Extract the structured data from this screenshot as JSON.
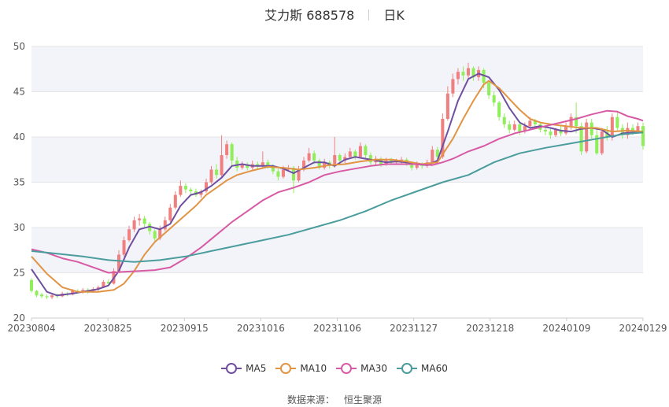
{
  "header": {
    "name": "艾力斯 688578",
    "period": "日K"
  },
  "source": {
    "label": "数据来源：",
    "provider": "恒生聚源"
  },
  "colors": {
    "up": "#f08080",
    "down": "#90ee5a",
    "grid": "#e6e6e6",
    "band": "#f3f4fa"
  },
  "chart_data": {
    "type": "candlestick",
    "ylim": [
      20,
      50
    ],
    "yticks": [
      20,
      25,
      30,
      35,
      40,
      45,
      50
    ],
    "xticks": [
      "20230804",
      "20230825",
      "20230915",
      "20231016",
      "20231106",
      "20231127",
      "20231218",
      "20240109",
      "20240129"
    ],
    "n_bars": 120,
    "candles": [
      [
        24.2,
        23.0,
        24.4,
        22.8
      ],
      [
        23.0,
        22.5,
        23.1,
        22.3
      ],
      [
        22.6,
        22.4,
        22.8,
        22.2
      ],
      [
        22.4,
        22.3,
        22.6,
        22.1
      ],
      [
        22.3,
        22.5,
        22.7,
        22.1
      ],
      [
        22.5,
        22.4,
        22.7,
        22.2
      ],
      [
        22.4,
        22.7,
        22.9,
        22.3
      ],
      [
        22.7,
        22.6,
        22.9,
        22.4
      ],
      [
        22.6,
        23.0,
        23.2,
        22.5
      ],
      [
        23.0,
        22.9,
        23.2,
        22.7
      ],
      [
        22.9,
        23.1,
        23.3,
        22.7
      ],
      [
        23.1,
        22.9,
        23.3,
        22.7
      ],
      [
        22.9,
        23.2,
        23.4,
        22.8
      ],
      [
        23.2,
        23.4,
        23.6,
        23.0
      ],
      [
        23.4,
        24.0,
        24.2,
        23.3
      ],
      [
        24.0,
        23.8,
        24.3,
        23.6
      ],
      [
        23.8,
        25.2,
        25.5,
        23.7
      ],
      [
        25.2,
        27.0,
        27.5,
        25.0
      ],
      [
        27.0,
        28.6,
        29.0,
        26.8
      ],
      [
        28.6,
        29.8,
        30.2,
        28.4
      ],
      [
        29.8,
        30.8,
        31.2,
        29.5
      ],
      [
        30.8,
        31.0,
        31.5,
        30.2
      ],
      [
        31.0,
        30.4,
        31.3,
        30.0
      ],
      [
        30.4,
        29.6,
        30.6,
        29.2
      ],
      [
        29.6,
        28.8,
        29.8,
        28.5
      ],
      [
        28.8,
        29.8,
        30.2,
        28.6
      ],
      [
        29.8,
        30.8,
        31.2,
        29.6
      ],
      [
        30.8,
        32.2,
        32.6,
        30.6
      ],
      [
        32.2,
        33.6,
        34.0,
        32.0
      ],
      [
        33.6,
        34.6,
        35.2,
        33.4
      ],
      [
        34.6,
        34.2,
        34.9,
        33.8
      ],
      [
        34.2,
        34.0,
        34.4,
        33.7
      ],
      [
        34.0,
        33.6,
        34.3,
        33.4
      ],
      [
        33.6,
        34.0,
        34.2,
        33.3
      ],
      [
        34.0,
        35.0,
        35.4,
        33.8
      ],
      [
        35.0,
        36.4,
        36.8,
        34.8
      ],
      [
        36.4,
        35.8,
        37.0,
        35.4
      ],
      [
        35.8,
        38.0,
        40.2,
        35.6
      ],
      [
        38.0,
        39.2,
        39.6,
        37.6
      ],
      [
        39.2,
        37.4,
        39.4,
        36.8
      ],
      [
        37.4,
        36.6,
        37.8,
        36.2
      ],
      [
        36.6,
        36.9,
        37.3,
        36.4
      ],
      [
        36.9,
        36.6,
        37.2,
        36.3
      ],
      [
        36.6,
        37.0,
        37.4,
        36.4
      ],
      [
        37.0,
        36.8,
        37.3,
        36.5
      ],
      [
        36.8,
        37.2,
        38.4,
        36.6
      ],
      [
        37.2,
        36.8,
        37.5,
        36.5
      ],
      [
        36.8,
        36.2,
        37.0,
        35.9
      ],
      [
        36.2,
        35.6,
        36.5,
        35.2
      ],
      [
        35.6,
        36.4,
        36.8,
        35.4
      ],
      [
        36.4,
        36.6,
        36.9,
        36.2
      ],
      [
        36.6,
        35.2,
        36.8,
        33.8
      ],
      [
        35.2,
        36.4,
        36.8,
        35.0
      ],
      [
        36.4,
        37.4,
        37.8,
        36.2
      ],
      [
        37.4,
        38.2,
        38.8,
        37.2
      ],
      [
        38.2,
        37.4,
        38.5,
        37.0
      ],
      [
        37.4,
        36.6,
        37.6,
        36.4
      ],
      [
        36.6,
        37.2,
        37.6,
        36.4
      ],
      [
        37.2,
        36.8,
        37.4,
        36.5
      ],
      [
        36.8,
        38.0,
        40.0,
        36.6
      ],
      [
        38.0,
        37.4,
        38.2,
        37.1
      ],
      [
        37.4,
        37.8,
        38.2,
        37.1
      ],
      [
        37.8,
        38.4,
        38.8,
        37.6
      ],
      [
        38.4,
        37.8,
        38.6,
        37.5
      ],
      [
        37.8,
        39.0,
        39.4,
        37.6
      ],
      [
        39.0,
        38.0,
        39.2,
        37.6
      ],
      [
        38.0,
        37.2,
        38.3,
        36.9
      ],
      [
        37.2,
        37.6,
        37.9,
        36.9
      ],
      [
        37.6,
        37.0,
        37.8,
        36.7
      ],
      [
        37.0,
        37.4,
        37.7,
        36.8
      ],
      [
        37.4,
        37.2,
        37.7,
        36.9
      ],
      [
        37.2,
        37.3,
        37.6,
        37.0
      ],
      [
        37.3,
        37.5,
        37.8,
        37.0
      ],
      [
        37.5,
        37.0,
        37.7,
        36.8
      ],
      [
        37.0,
        36.6,
        37.2,
        36.3
      ],
      [
        36.6,
        37.0,
        37.3,
        36.4
      ],
      [
        37.0,
        36.8,
        37.2,
        36.5
      ],
      [
        36.8,
        37.2,
        37.5,
        36.6
      ],
      [
        37.2,
        38.6,
        39.0,
        37.0
      ],
      [
        38.6,
        37.8,
        38.9,
        37.5
      ],
      [
        37.8,
        42.0,
        42.6,
        37.6
      ],
      [
        42.0,
        44.8,
        45.6,
        41.8
      ],
      [
        44.8,
        46.4,
        47.0,
        44.4
      ],
      [
        46.4,
        47.2,
        47.6,
        45.8
      ],
      [
        47.2,
        46.8,
        47.8,
        46.2
      ],
      [
        46.8,
        47.6,
        48.2,
        46.4
      ],
      [
        47.6,
        46.6,
        47.8,
        46.2
      ],
      [
        46.6,
        47.4,
        47.8,
        46.2
      ],
      [
        47.4,
        46.0,
        47.6,
        45.4
      ],
      [
        46.0,
        44.6,
        46.2,
        44.2
      ],
      [
        44.6,
        43.8,
        45.0,
        43.4
      ],
      [
        43.8,
        42.2,
        44.0,
        41.8
      ],
      [
        42.2,
        41.4,
        42.6,
        41.0
      ],
      [
        41.4,
        40.8,
        41.8,
        40.4
      ],
      [
        40.8,
        41.4,
        41.8,
        40.6
      ],
      [
        41.4,
        40.6,
        41.6,
        40.2
      ],
      [
        40.6,
        41.2,
        41.6,
        40.4
      ],
      [
        41.2,
        41.8,
        42.2,
        41.0
      ],
      [
        41.8,
        41.4,
        42.0,
        41.0
      ],
      [
        41.4,
        40.8,
        41.6,
        40.5
      ],
      [
        40.8,
        40.6,
        41.2,
        40.2
      ],
      [
        40.6,
        40.2,
        40.9,
        39.8
      ],
      [
        40.2,
        40.8,
        41.0,
        40.0
      ],
      [
        40.8,
        40.4,
        41.2,
        40.1
      ],
      [
        40.4,
        41.2,
        41.6,
        40.2
      ],
      [
        41.2,
        42.2,
        42.6,
        40.8
      ],
      [
        42.2,
        41.2,
        43.8,
        40.4
      ],
      [
        41.2,
        38.4,
        41.6,
        38.0
      ],
      [
        38.4,
        41.6,
        42.0,
        38.2
      ],
      [
        41.6,
        40.2,
        42.0,
        39.8
      ],
      [
        40.2,
        38.2,
        40.8,
        38.0
      ],
      [
        38.2,
        40.6,
        41.0,
        38.0
      ],
      [
        40.6,
        40.0,
        41.2,
        39.6
      ],
      [
        40.0,
        42.2,
        42.6,
        39.6
      ],
      [
        42.2,
        41.0,
        42.8,
        40.6
      ],
      [
        41.0,
        40.2,
        41.4,
        39.8
      ],
      [
        40.2,
        41.0,
        41.6,
        39.8
      ],
      [
        41.0,
        40.6,
        41.4,
        40.2
      ],
      [
        40.6,
        41.2,
        41.6,
        40.4
      ],
      [
        41.2,
        39.0,
        41.6,
        38.6
      ]
    ],
    "series": [
      {
        "name": "MA5",
        "color": "#6e4fa0",
        "points": [
          [
            0,
            25.4
          ],
          [
            3,
            22.9
          ],
          [
            5,
            22.5
          ],
          [
            8,
            22.7
          ],
          [
            13,
            23.2
          ],
          [
            15,
            23.6
          ],
          [
            17,
            25.2
          ],
          [
            19,
            27.8
          ],
          [
            21,
            29.8
          ],
          [
            23,
            30.1
          ],
          [
            25,
            29.8
          ],
          [
            27,
            30.4
          ],
          [
            29,
            32.4
          ],
          [
            31,
            33.6
          ],
          [
            33,
            33.9
          ],
          [
            35,
            34.6
          ],
          [
            37,
            35.5
          ],
          [
            39,
            36.8
          ],
          [
            41,
            37.0
          ],
          [
            43,
            36.8
          ],
          [
            45,
            36.8
          ],
          [
            47,
            36.8
          ],
          [
            49,
            36.5
          ],
          [
            51,
            36.0
          ],
          [
            53,
            36.6
          ],
          [
            55,
            37.2
          ],
          [
            57,
            37.2
          ],
          [
            59,
            36.8
          ],
          [
            61,
            37.5
          ],
          [
            63,
            37.8
          ],
          [
            65,
            37.6
          ],
          [
            67,
            37.4
          ],
          [
            69,
            37.2
          ],
          [
            71,
            37.3
          ],
          [
            73,
            37.2
          ],
          [
            75,
            37.0
          ],
          [
            77,
            36.9
          ],
          [
            79,
            37.4
          ],
          [
            81,
            40.6
          ],
          [
            83,
            44.0
          ],
          [
            85,
            46.4
          ],
          [
            87,
            47.0
          ],
          [
            89,
            46.6
          ],
          [
            91,
            45.2
          ],
          [
            93,
            43.2
          ],
          [
            95,
            41.6
          ],
          [
            97,
            41.0
          ],
          [
            99,
            41.2
          ],
          [
            101,
            41.0
          ],
          [
            103,
            40.7
          ],
          [
            105,
            40.6
          ],
          [
            107,
            40.9
          ],
          [
            109,
            41.0
          ],
          [
            111,
            40.8
          ],
          [
            113,
            40.0
          ],
          [
            115,
            40.4
          ],
          [
            117,
            40.5
          ],
          [
            119,
            40.5
          ]
        ]
      },
      {
        "name": "MA10",
        "color": "#e09444",
        "points": [
          [
            0,
            26.8
          ],
          [
            3,
            24.9
          ],
          [
            6,
            23.4
          ],
          [
            9,
            22.9
          ],
          [
            13,
            22.9
          ],
          [
            16,
            23.1
          ],
          [
            18,
            23.8
          ],
          [
            20,
            25.2
          ],
          [
            22,
            27.0
          ],
          [
            24,
            28.4
          ],
          [
            26,
            29.4
          ],
          [
            28,
            30.4
          ],
          [
            30,
            31.4
          ],
          [
            32,
            32.4
          ],
          [
            34,
            33.6
          ],
          [
            36,
            34.4
          ],
          [
            38,
            35.2
          ],
          [
            40,
            35.8
          ],
          [
            43,
            36.3
          ],
          [
            46,
            36.7
          ],
          [
            49,
            36.6
          ],
          [
            52,
            36.4
          ],
          [
            55,
            36.6
          ],
          [
            58,
            36.9
          ],
          [
            61,
            37.0
          ],
          [
            64,
            37.3
          ],
          [
            67,
            37.5
          ],
          [
            70,
            37.5
          ],
          [
            73,
            37.3
          ],
          [
            76,
            37.0
          ],
          [
            79,
            37.2
          ],
          [
            82,
            39.8
          ],
          [
            84,
            42.0
          ],
          [
            86,
            44.0
          ],
          [
            88,
            45.8
          ],
          [
            89,
            46.2
          ],
          [
            91,
            45.4
          ],
          [
            93,
            44.2
          ],
          [
            95,
            43.0
          ],
          [
            97,
            42.0
          ],
          [
            99,
            41.6
          ],
          [
            101,
            41.4
          ],
          [
            104,
            41.2
          ],
          [
            107,
            41.0
          ],
          [
            110,
            41.0
          ],
          [
            113,
            40.6
          ],
          [
            116,
            40.7
          ],
          [
            119,
            40.6
          ]
        ]
      },
      {
        "name": "MA30",
        "color": "#d85aa4",
        "points": [
          [
            0,
            27.6
          ],
          [
            3,
            27.2
          ],
          [
            6,
            26.6
          ],
          [
            9,
            26.2
          ],
          [
            12,
            25.6
          ],
          [
            15,
            25.0
          ],
          [
            18,
            25.1
          ],
          [
            21,
            25.2
          ],
          [
            24,
            25.3
          ],
          [
            27,
            25.6
          ],
          [
            30,
            26.6
          ],
          [
            33,
            27.8
          ],
          [
            36,
            29.2
          ],
          [
            39,
            30.6
          ],
          [
            42,
            31.8
          ],
          [
            45,
            33.0
          ],
          [
            48,
            33.9
          ],
          [
            51,
            34.4
          ],
          [
            54,
            35.0
          ],
          [
            57,
            35.8
          ],
          [
            60,
            36.2
          ],
          [
            63,
            36.5
          ],
          [
            66,
            36.8
          ],
          [
            69,
            37.0
          ],
          [
            72,
            37.0
          ],
          [
            75,
            37.0
          ],
          [
            78,
            36.9
          ],
          [
            80,
            37.2
          ],
          [
            82,
            37.6
          ],
          [
            85,
            38.4
          ],
          [
            88,
            39.0
          ],
          [
            91,
            39.8
          ],
          [
            94,
            40.4
          ],
          [
            97,
            40.8
          ],
          [
            100,
            41.2
          ],
          [
            103,
            41.6
          ],
          [
            106,
            42.0
          ],
          [
            109,
            42.5
          ],
          [
            112,
            42.9
          ],
          [
            114,
            42.8
          ],
          [
            116,
            42.3
          ],
          [
            118,
            42.0
          ],
          [
            119,
            41.8
          ]
        ]
      },
      {
        "name": "MA60",
        "color": "#4a9d9c",
        "points": [
          [
            0,
            27.4
          ],
          [
            5,
            27.1
          ],
          [
            10,
            26.8
          ],
          [
            15,
            26.4
          ],
          [
            20,
            26.2
          ],
          [
            25,
            26.4
          ],
          [
            30,
            26.8
          ],
          [
            35,
            27.4
          ],
          [
            40,
            28.0
          ],
          [
            45,
            28.6
          ],
          [
            50,
            29.2
          ],
          [
            55,
            30.0
          ],
          [
            60,
            30.8
          ],
          [
            65,
            31.8
          ],
          [
            70,
            33.0
          ],
          [
            75,
            34.0
          ],
          [
            80,
            35.0
          ],
          [
            85,
            35.8
          ],
          [
            90,
            37.2
          ],
          [
            95,
            38.2
          ],
          [
            100,
            38.8
          ],
          [
            105,
            39.3
          ],
          [
            110,
            39.8
          ],
          [
            115,
            40.3
          ],
          [
            119,
            40.5
          ]
        ]
      }
    ]
  }
}
